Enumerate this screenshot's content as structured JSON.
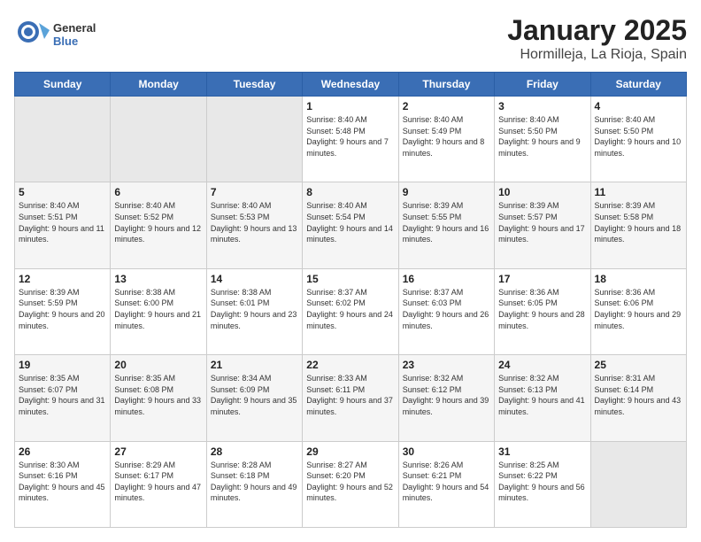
{
  "logo": {
    "general": "General",
    "blue": "Blue"
  },
  "header": {
    "title": "January 2025",
    "subtitle": "Hormilleja, La Rioja, Spain"
  },
  "weekdays": [
    "Sunday",
    "Monday",
    "Tuesday",
    "Wednesday",
    "Thursday",
    "Friday",
    "Saturday"
  ],
  "weeks": [
    [
      {
        "day": "",
        "empty": true
      },
      {
        "day": "",
        "empty": true
      },
      {
        "day": "",
        "empty": true
      },
      {
        "day": "1",
        "sunrise": "8:40 AM",
        "sunset": "5:48 PM",
        "daylight": "9 hours and 7 minutes."
      },
      {
        "day": "2",
        "sunrise": "8:40 AM",
        "sunset": "5:49 PM",
        "daylight": "9 hours and 8 minutes."
      },
      {
        "day": "3",
        "sunrise": "8:40 AM",
        "sunset": "5:50 PM",
        "daylight": "9 hours and 9 minutes."
      },
      {
        "day": "4",
        "sunrise": "8:40 AM",
        "sunset": "5:50 PM",
        "daylight": "9 hours and 10 minutes."
      }
    ],
    [
      {
        "day": "5",
        "sunrise": "8:40 AM",
        "sunset": "5:51 PM",
        "daylight": "9 hours and 11 minutes."
      },
      {
        "day": "6",
        "sunrise": "8:40 AM",
        "sunset": "5:52 PM",
        "daylight": "9 hours and 12 minutes."
      },
      {
        "day": "7",
        "sunrise": "8:40 AM",
        "sunset": "5:53 PM",
        "daylight": "9 hours and 13 minutes."
      },
      {
        "day": "8",
        "sunrise": "8:40 AM",
        "sunset": "5:54 PM",
        "daylight": "9 hours and 14 minutes."
      },
      {
        "day": "9",
        "sunrise": "8:39 AM",
        "sunset": "5:55 PM",
        "daylight": "9 hours and 16 minutes."
      },
      {
        "day": "10",
        "sunrise": "8:39 AM",
        "sunset": "5:57 PM",
        "daylight": "9 hours and 17 minutes."
      },
      {
        "day": "11",
        "sunrise": "8:39 AM",
        "sunset": "5:58 PM",
        "daylight": "9 hours and 18 minutes."
      }
    ],
    [
      {
        "day": "12",
        "sunrise": "8:39 AM",
        "sunset": "5:59 PM",
        "daylight": "9 hours and 20 minutes."
      },
      {
        "day": "13",
        "sunrise": "8:38 AM",
        "sunset": "6:00 PM",
        "daylight": "9 hours and 21 minutes."
      },
      {
        "day": "14",
        "sunrise": "8:38 AM",
        "sunset": "6:01 PM",
        "daylight": "9 hours and 23 minutes."
      },
      {
        "day": "15",
        "sunrise": "8:37 AM",
        "sunset": "6:02 PM",
        "daylight": "9 hours and 24 minutes."
      },
      {
        "day": "16",
        "sunrise": "8:37 AM",
        "sunset": "6:03 PM",
        "daylight": "9 hours and 26 minutes."
      },
      {
        "day": "17",
        "sunrise": "8:36 AM",
        "sunset": "6:05 PM",
        "daylight": "9 hours and 28 minutes."
      },
      {
        "day": "18",
        "sunrise": "8:36 AM",
        "sunset": "6:06 PM",
        "daylight": "9 hours and 29 minutes."
      }
    ],
    [
      {
        "day": "19",
        "sunrise": "8:35 AM",
        "sunset": "6:07 PM",
        "daylight": "9 hours and 31 minutes."
      },
      {
        "day": "20",
        "sunrise": "8:35 AM",
        "sunset": "6:08 PM",
        "daylight": "9 hours and 33 minutes."
      },
      {
        "day": "21",
        "sunrise": "8:34 AM",
        "sunset": "6:09 PM",
        "daylight": "9 hours and 35 minutes."
      },
      {
        "day": "22",
        "sunrise": "8:33 AM",
        "sunset": "6:11 PM",
        "daylight": "9 hours and 37 minutes."
      },
      {
        "day": "23",
        "sunrise": "8:32 AM",
        "sunset": "6:12 PM",
        "daylight": "9 hours and 39 minutes."
      },
      {
        "day": "24",
        "sunrise": "8:32 AM",
        "sunset": "6:13 PM",
        "daylight": "9 hours and 41 minutes."
      },
      {
        "day": "25",
        "sunrise": "8:31 AM",
        "sunset": "6:14 PM",
        "daylight": "9 hours and 43 minutes."
      }
    ],
    [
      {
        "day": "26",
        "sunrise": "8:30 AM",
        "sunset": "6:16 PM",
        "daylight": "9 hours and 45 minutes."
      },
      {
        "day": "27",
        "sunrise": "8:29 AM",
        "sunset": "6:17 PM",
        "daylight": "9 hours and 47 minutes."
      },
      {
        "day": "28",
        "sunrise": "8:28 AM",
        "sunset": "6:18 PM",
        "daylight": "9 hours and 49 minutes."
      },
      {
        "day": "29",
        "sunrise": "8:27 AM",
        "sunset": "6:20 PM",
        "daylight": "9 hours and 52 minutes."
      },
      {
        "day": "30",
        "sunrise": "8:26 AM",
        "sunset": "6:21 PM",
        "daylight": "9 hours and 54 minutes."
      },
      {
        "day": "31",
        "sunrise": "8:25 AM",
        "sunset": "6:22 PM",
        "daylight": "9 hours and 56 minutes."
      },
      {
        "day": "",
        "empty": true
      }
    ]
  ],
  "labels": {
    "sunrise": "Sunrise:",
    "sunset": "Sunset:",
    "daylight": "Daylight:"
  }
}
